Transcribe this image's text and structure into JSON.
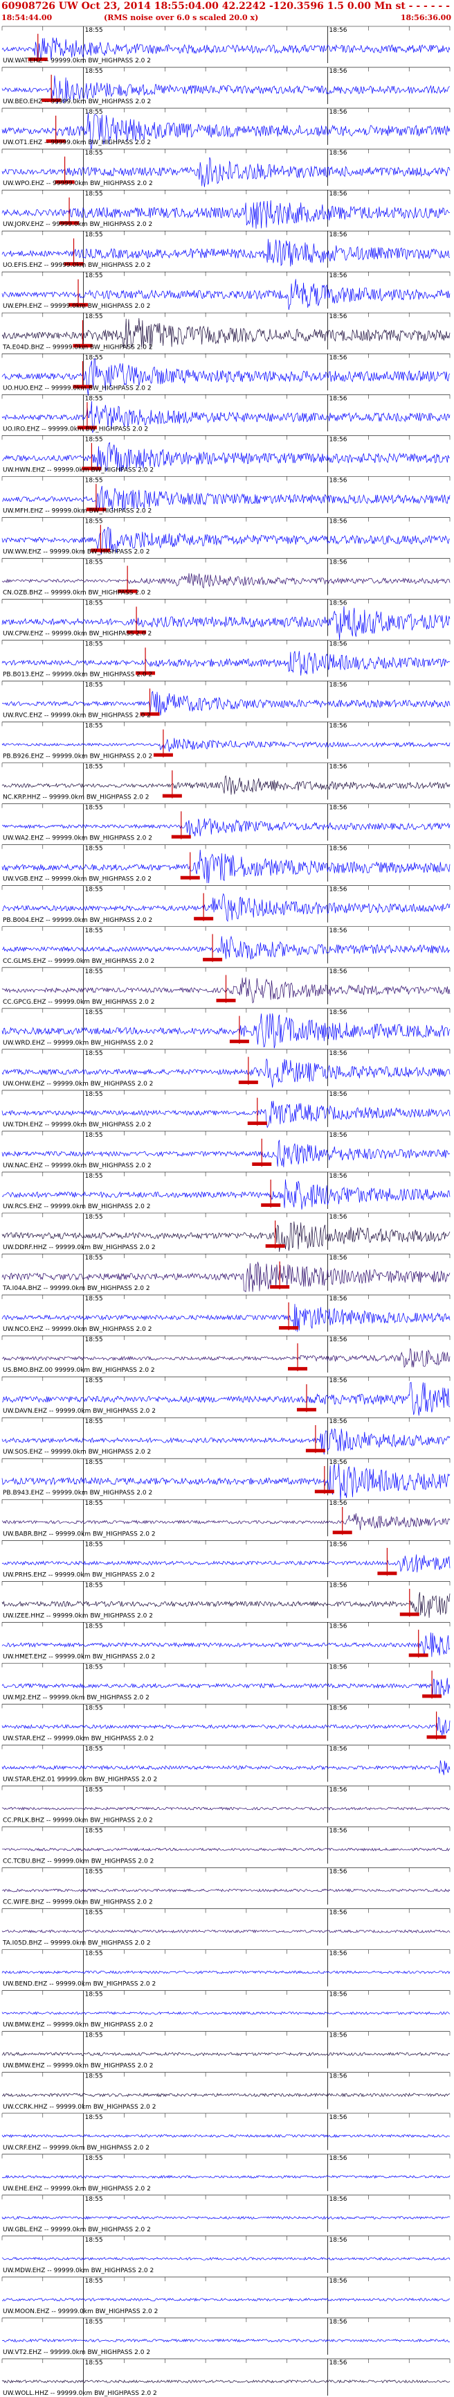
{
  "header": {
    "line1": "60908726 UW Oct 23, 2014 18:55:04.00    42.2242  -120.3596   1.5 0.00 Mn st - - - - - -  1",
    "start_time": "18:54:44.00",
    "subtitle": "(RMS noise over 6.0 s scaled 20.0 x)",
    "end_time": "18:56:36.00"
  },
  "colors": {
    "trace_blue": "#0000ff",
    "trace_dark": "#1a0a3a",
    "trace_purple": "#2d0b6b",
    "pick_red": "#cc0000",
    "grid": "#000000"
  },
  "chart_data": {
    "type": "line",
    "title": "60908726 UW Oct 23, 2014 18:55:04.00 42.2242 -120.3596 1.5 0.00 Mn st",
    "tick_labels": [
      "18:55",
      "18:56"
    ],
    "series": [
      {
        "label": "UW.WAT.EHZ -- 99999.0km BW_HIGHPASS 2.0 2",
        "color": "blue",
        "pick": 0.08,
        "burst": 0.08,
        "amp": 0.9
      },
      {
        "label": "UW.BEO.EHZ -- 99999.0km BW_HIGHPASS 2.0 2",
        "color": "blue",
        "pick": 0.11,
        "burst": 0.12,
        "amp": 0.9
      },
      {
        "label": "UW.OT1.EHZ -- 99999.0km BW_HIGHPASS 2.0 2",
        "color": "blue",
        "pick": 0.12,
        "burst": 0.2,
        "amp": 1.2
      },
      {
        "label": "UW.WPO.EHZ -- 99999.0km BW_HIGHPASS 2.0 2",
        "color": "blue",
        "pick": 0.14,
        "burst": 0.45,
        "amp": 1.0
      },
      {
        "label": "UW.JORV.EHZ -- 99999.0km BW_HIGHPASS 2.0 2",
        "color": "blue",
        "pick": 0.15,
        "burst": 0.55,
        "amp": 1.2
      },
      {
        "label": "UO.EFIS.EHZ -- 99999.0km BW_HIGHPASS 2.0 2",
        "color": "blue",
        "pick": 0.16,
        "burst": 0.6,
        "amp": 1.1
      },
      {
        "label": "UW.EPH.EHZ -- 99999.0km BW_HIGHPASS 2.0 2",
        "color": "blue",
        "pick": 0.17,
        "burst": 0.65,
        "amp": 1.0
      },
      {
        "label": "TA.E04D.BHZ -- 99999.0km BW_HIGHPASS 2.0 2",
        "color": "dark",
        "pick": 0.18,
        "burst": 0.28,
        "amp": 1.3
      },
      {
        "label": "UO.HUO.EHZ -- 99999.0km BW_HIGHPASS 2.0 2",
        "color": "blue",
        "pick": 0.18,
        "burst": 0.2,
        "amp": 1.2
      },
      {
        "label": "UO.IRO.EHZ -- 99999.0km BW_HIGHPASS 2.0 2",
        "color": "blue",
        "pick": 0.19,
        "burst": 0.2,
        "amp": 1.0
      },
      {
        "label": "UW.HWN.EHZ -- 99999.0km BW_HIGHPASS 2.0 2",
        "color": "blue",
        "pick": 0.2,
        "burst": 0.22,
        "amp": 1.1
      },
      {
        "label": "UW.MFH.EHZ -- 99999.0km BW_HIGHPASS 2.0 2",
        "color": "blue",
        "pick": 0.21,
        "burst": 0.22,
        "amp": 1.0
      },
      {
        "label": "UW.WW.EHZ -- 99999.0km BW_HIGHPASS 2.0 2",
        "color": "blue",
        "pick": 0.22,
        "burst": 0.22,
        "amp": 1.0
      },
      {
        "label": "CN.OZB.BHZ -- 99999.0km BW_HIGHPASS 2.0 2",
        "color": "purple",
        "pick": 0.28,
        "burst": 0.4,
        "amp": 0.6
      },
      {
        "label": "UW.CPW.EHZ -- 99999.0km BW_HIGHPASS 2.0 2",
        "color": "blue",
        "pick": 0.3,
        "burst": 0.75,
        "amp": 1.2
      },
      {
        "label": "PB.B013.EHZ -- 99999.0km BW_HIGHPASS 2.0 2",
        "color": "blue",
        "pick": 0.32,
        "burst": 0.65,
        "amp": 0.9
      },
      {
        "label": "UW.RVC.EHZ -- 99999.0km BW_HIGHPASS 2.0 2",
        "color": "blue",
        "pick": 0.33,
        "burst": 0.34,
        "amp": 0.8
      },
      {
        "label": "PB.B926.EHZ -- 99999.0km BW_HIGHPASS 2.0 2",
        "color": "blue",
        "pick": 0.36,
        "burst": 0.36,
        "amp": 0.5
      },
      {
        "label": "NC.KRP.HHZ -- 99999.0km BW_HIGHPASS 2.0 2",
        "color": "dark",
        "pick": 0.38,
        "burst": 0.5,
        "amp": 0.7
      },
      {
        "label": "UW.WA2.EHZ -- 99999.0km BW_HIGHPASS 2.0 2",
        "color": "blue",
        "pick": 0.4,
        "burst": 0.42,
        "amp": 0.7
      },
      {
        "label": "UW.VGB.EHZ -- 99999.0km BW_HIGHPASS 2.0 2",
        "color": "blue",
        "pick": 0.42,
        "burst": 0.44,
        "amp": 1.2
      },
      {
        "label": "PB.B004.EHZ -- 99999.0km BW_HIGHPASS 2.0 2",
        "color": "blue",
        "pick": 0.45,
        "burst": 0.48,
        "amp": 1.0
      },
      {
        "label": "CC.GLMS.EHZ -- 99999.0km BW_HIGHPASS 2.0 2",
        "color": "blue",
        "pick": 0.47,
        "burst": 0.5,
        "amp": 0.9
      },
      {
        "label": "CC.GPCG.EHZ -- 99999.0km BW_HIGHPASS 2.0 2",
        "color": "purple",
        "pick": 0.5,
        "burst": 0.54,
        "amp": 0.9
      },
      {
        "label": "UW.WRD.EHZ -- 99999.0km BW_HIGHPASS 2.0 2",
        "color": "blue",
        "pick": 0.53,
        "burst": 0.58,
        "amp": 1.3
      },
      {
        "label": "UW.OHW.EHZ -- 99999.0km BW_HIGHPASS 2.0 2",
        "color": "blue",
        "pick": 0.55,
        "burst": 0.6,
        "amp": 1.0
      },
      {
        "label": "UW.TDH.EHZ -- 99999.0km BW_HIGHPASS 2.0 2",
        "color": "blue",
        "pick": 0.57,
        "burst": 0.6,
        "amp": 0.9
      },
      {
        "label": "UW.NAC.EHZ -- 99999.0km BW_HIGHPASS 2.0 2",
        "color": "blue",
        "pick": 0.58,
        "burst": 0.62,
        "amp": 0.9
      },
      {
        "label": "UW.RCS.EHZ -- 99999.0km BW_HIGHPASS 2.0 2",
        "color": "blue",
        "pick": 0.6,
        "burst": 0.64,
        "amp": 1.1
      },
      {
        "label": "UW.DDRF.HHZ -- 99999.0km BW_HIGHPASS 2.0 2",
        "color": "dark",
        "pick": 0.61,
        "burst": 0.62,
        "amp": 1.2
      },
      {
        "label": "TA.I04A.BHZ -- 99999.0km BW_HIGHPASS 2.0 2",
        "color": "purple",
        "pick": 0.62,
        "burst": 0.55,
        "amp": 1.3
      },
      {
        "label": "UW.NCO.EHZ -- 99999.0km BW_HIGHPASS 2.0 2",
        "color": "blue",
        "pick": 0.64,
        "burst": 0.66,
        "amp": 0.9
      },
      {
        "label": "US.BMO.BHZ.00 99999.0km BW_HIGHPASS 2.0 2",
        "color": "purple",
        "pick": 0.66,
        "burst": 0.9,
        "amp": 0.7
      },
      {
        "label": "UW.DAVN.EHZ -- 99999.0km BW_HIGHPASS 2.0 2",
        "color": "blue",
        "pick": 0.68,
        "burst": 0.92,
        "amp": 1.2
      },
      {
        "label": "UW.SOS.EHZ -- 99999.0km BW_HIGHPASS 2.0 2",
        "color": "blue",
        "pick": 0.7,
        "burst": 0.72,
        "amp": 0.9
      },
      {
        "label": "PB.B943.EHZ -- 99999.0km BW_HIGHPASS 2.0 2",
        "color": "blue",
        "pick": 0.72,
        "burst": 0.74,
        "amp": 1.3
      },
      {
        "label": "UW.BABR.BHZ -- 99999.0km BW_HIGHPASS 2.0 2",
        "color": "purple",
        "pick": 0.76,
        "burst": 0.78,
        "amp": 0.6
      },
      {
        "label": "UW.PRHS.EHZ -- 99999.0km BW_HIGHPASS 2.0 2",
        "color": "blue",
        "pick": 0.86,
        "burst": 0.9,
        "amp": 0.7
      },
      {
        "label": "UW.IZEE.HHZ -- 99999.0km BW_HIGHPASS 2.0 2",
        "color": "dark",
        "pick": 0.91,
        "burst": 0.93,
        "amp": 1.0
      },
      {
        "label": "UW.HMET.EHZ -- 99999.0km BW_HIGHPASS 2.0 2",
        "color": "blue",
        "pick": 0.93,
        "burst": 0.95,
        "amp": 0.8
      },
      {
        "label": "UW.MJ2.EHZ -- 99999.0km BW_HIGHPASS 2.0 2",
        "color": "blue",
        "pick": 0.96,
        "burst": 0.97,
        "amp": 0.8
      },
      {
        "label": "UW.STAR.EHZ -- 99999.0km BW_HIGHPASS 2.0 2",
        "color": "blue",
        "pick": 0.97,
        "burst": 0.98,
        "amp": 0.7
      },
      {
        "label": "UW.STAR.EHZ.01 99999.0km BW_HIGHPASS 2.0 2",
        "color": "blue",
        "pick": null,
        "burst": 0.985,
        "amp": 0.7
      },
      {
        "label": "CC.PRLK.BHZ -- 99999.0km BW_HIGHPASS 2.0 2",
        "color": "purple",
        "pick": null,
        "burst": null,
        "amp": 0.5
      },
      {
        "label": "CC.TCBU.BHZ -- 99999.0km BW_HIGHPASS 2.0 2",
        "color": "purple",
        "pick": null,
        "burst": null,
        "amp": 0.5
      },
      {
        "label": "CC.WIFE.BHZ -- 99999.0km BW_HIGHPASS 2.0 2",
        "color": "purple",
        "pick": null,
        "burst": null,
        "amp": 0.5
      },
      {
        "label": "TA.I05D.BHZ -- 99999.0km BW_HIGHPASS 2.0 2",
        "color": "purple",
        "pick": null,
        "burst": null,
        "amp": 0.5
      },
      {
        "label": "UW.BEND.EHZ -- 99999.0km BW_HIGHPASS 2.0 2",
        "color": "blue",
        "pick": null,
        "burst": null,
        "amp": 0.5
      },
      {
        "label": "UW.BMW.EHZ -- 99999.0km BW_HIGHPASS 2.0 2",
        "color": "blue",
        "pick": null,
        "burst": null,
        "amp": 0.5
      },
      {
        "label": "UW.BMW.EHZ -- 99999.0km BW_HIGHPASS 2.0 2",
        "color": "dark",
        "pick": null,
        "burst": null,
        "amp": 0.6
      },
      {
        "label": "UW.CCRK.HHZ -- 99999.0km BW_HIGHPASS 2.0 2",
        "color": "dark",
        "pick": null,
        "burst": null,
        "amp": 0.6
      },
      {
        "label": "UW.CRF.EHZ -- 99999.0km BW_HIGHPASS 2.0 2",
        "color": "blue",
        "pick": null,
        "burst": null,
        "amp": 0.5
      },
      {
        "label": "UW.EHE.EHZ -- 99999.0km BW_HIGHPASS 2.0 2",
        "color": "blue",
        "pick": null,
        "burst": null,
        "amp": 0.5
      },
      {
        "label": "UW.GBL.EHZ -- 99999.0km BW_HIGHPASS 2.0 2",
        "color": "blue",
        "pick": null,
        "burst": null,
        "amp": 0.5
      },
      {
        "label": "UW.MDW.EHZ -- 99999.0km BW_HIGHPASS 2.0 2",
        "color": "blue",
        "pick": null,
        "burst": null,
        "amp": 0.5
      },
      {
        "label": "UW.MOON.EHZ -- 99999.0km BW_HIGHPASS 2.0 2",
        "color": "blue",
        "pick": null,
        "burst": null,
        "amp": 0.5
      },
      {
        "label": "UW.VT2.EHZ -- 99999.0km BW_HIGHPASS 2.0 2",
        "color": "blue",
        "pick": null,
        "burst": null,
        "amp": 0.5
      },
      {
        "label": "UW.WOLL.HHZ -- 99999.0km BW_HIGHPASS 2.0 2",
        "color": "dark",
        "pick": null,
        "burst": null,
        "amp": 0.5
      }
    ]
  }
}
